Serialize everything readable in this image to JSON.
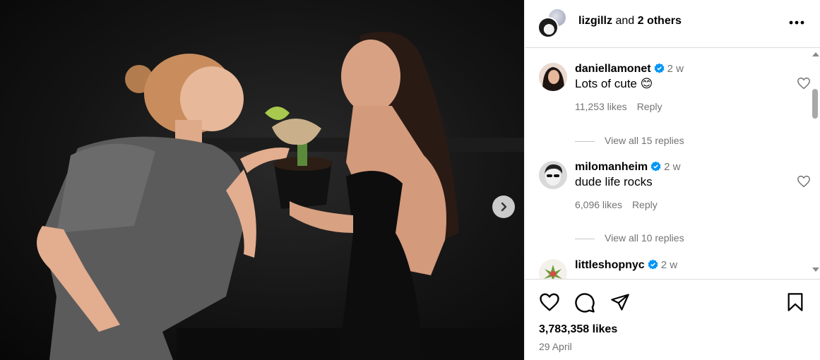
{
  "post": {
    "header": {
      "username": "lizgillz",
      "joiner": " and ",
      "others": "2 others"
    },
    "comments": [
      {
        "username": "daniellamonet",
        "verified": true,
        "time": "2 w",
        "text": "Lots of cute 😊",
        "likes": "11,253 likes",
        "reply_label": "Reply",
        "view_replies": "View all 15 replies"
      },
      {
        "username": "milomanheim",
        "verified": true,
        "time": "2 w",
        "text": "dude life rocks",
        "likes": "6,096 likes",
        "reply_label": "Reply",
        "view_replies": "View all 10 replies"
      },
      {
        "username": "littleshopnyc",
        "verified": true,
        "time": "2 w"
      }
    ],
    "likes_count": "3,783,358 likes",
    "date": "29 April"
  },
  "icons": {
    "more": "more-horizontal-icon",
    "next": "chevron-right-icon",
    "like": "heart-icon",
    "comment": "comment-bubble-icon",
    "share": "send-icon",
    "save": "bookmark-icon"
  },
  "colors": {
    "verified": "#0095f6",
    "muted": "#737373",
    "divider": "#dbdbdb"
  }
}
